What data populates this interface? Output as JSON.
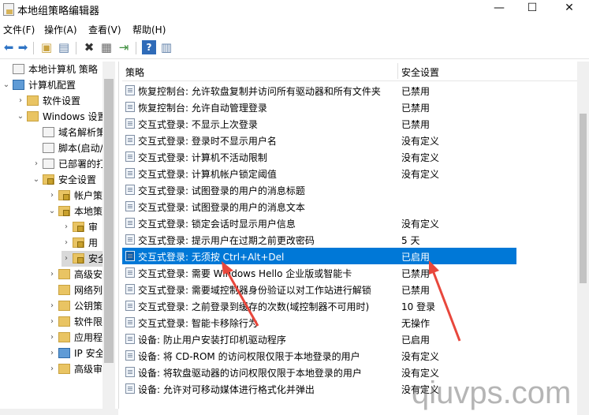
{
  "window": {
    "title": "本地组策略编辑器",
    "minimize": "—",
    "maximize": "☐",
    "close": "✕"
  },
  "menu": [
    "文件(F)",
    "操作(A)",
    "查看(V)",
    "帮助(H)"
  ],
  "tree": [
    {
      "label": "本地计算机 策略",
      "expander": "",
      "icon": "doc"
    },
    {
      "label": "计算机配置",
      "expander": "⌄",
      "icon": "comp"
    },
    {
      "label": "软件设置",
      "expander": "›",
      "icon": "folder"
    },
    {
      "label": "Windows 设置",
      "expander": "⌄",
      "icon": "folder"
    },
    {
      "label": "域名解析策",
      "expander": "",
      "icon": "doc"
    },
    {
      "label": "脚本(启动/",
      "expander": "",
      "icon": "doc"
    },
    {
      "label": "已部署的打",
      "expander": "›",
      "icon": "doc"
    },
    {
      "label": "安全设置",
      "expander": "⌄",
      "icon": "lockf"
    },
    {
      "label": "帐户策",
      "expander": "›",
      "icon": "lockf"
    },
    {
      "label": "本地策",
      "expander": "⌄",
      "icon": "lockf"
    },
    {
      "label": "审",
      "expander": "›",
      "icon": "lockf"
    },
    {
      "label": "用",
      "expander": "›",
      "icon": "lockf"
    },
    {
      "label": "安全",
      "expander": "›",
      "icon": "lockf"
    },
    {
      "label": "高级安",
      "expander": "›",
      "icon": "folder"
    },
    {
      "label": "网络列",
      "expander": "",
      "icon": "folder"
    },
    {
      "label": "公钥策",
      "expander": "›",
      "icon": "folder"
    },
    {
      "label": "软件限",
      "expander": "›",
      "icon": "folder"
    },
    {
      "label": "应用程",
      "expander": "›",
      "icon": "folder"
    },
    {
      "label": "IP 安全",
      "expander": "›",
      "icon": "folder"
    },
    {
      "label": "高级审",
      "expander": "›",
      "icon": "folder"
    }
  ],
  "columns": {
    "policy": "策略",
    "setting": "安全设置"
  },
  "policies": [
    {
      "name": "恢复控制台: 允许软盘复制并访问所有驱动器和所有文件夹",
      "value": "已禁用"
    },
    {
      "name": "恢复控制台: 允许自动管理登录",
      "value": "已禁用"
    },
    {
      "name": "交互式登录: 不显示上次登录",
      "value": "已禁用"
    },
    {
      "name": "交互式登录: 登录时不显示用户名",
      "value": "没有定义"
    },
    {
      "name": "交互式登录: 计算机不活动限制",
      "value": "没有定义"
    },
    {
      "name": "交互式登录: 计算机帐户锁定阈值",
      "value": "没有定义"
    },
    {
      "name": "交互式登录: 试图登录的用户的消息标题",
      "value": ""
    },
    {
      "name": "交互式登录: 试图登录的用户的消息文本",
      "value": ""
    },
    {
      "name": "交互式登录: 锁定会话时显示用户信息",
      "value": "没有定义"
    },
    {
      "name": "交互式登录: 提示用户在过期之前更改密码",
      "value": "5 天"
    },
    {
      "name": "交互式登录: 无须按 Ctrl+Alt+Del",
      "value": "已启用",
      "selected": true
    },
    {
      "name": "交互式登录: 需要 Windows Hello 企业版或智能卡",
      "value": "已禁用"
    },
    {
      "name": "交互式登录: 需要域控制器身份验证以对工作站进行解锁",
      "value": "已禁用"
    },
    {
      "name": "交互式登录: 之前登录到缓存的次数(域控制器不可用时)",
      "value": "10 登录"
    },
    {
      "name": "交互式登录: 智能卡移除行为",
      "value": "无操作"
    },
    {
      "name": "设备: 防止用户安装打印机驱动程序",
      "value": "已启用"
    },
    {
      "name": "设备: 将 CD-ROM 的访问权限仅限于本地登录的用户",
      "value": "没有定义"
    },
    {
      "name": "设备: 将软盘驱动器的访问权限仅限于本地登录的用户",
      "value": "没有定义"
    },
    {
      "name": "设备: 允许对可移动媒体进行格式化并弹出",
      "value": "没有定义"
    }
  ],
  "watermark": "qiuvps.com",
  "colors": {
    "selection": "#0078d7",
    "annotation_arrow": "#e8473c"
  }
}
